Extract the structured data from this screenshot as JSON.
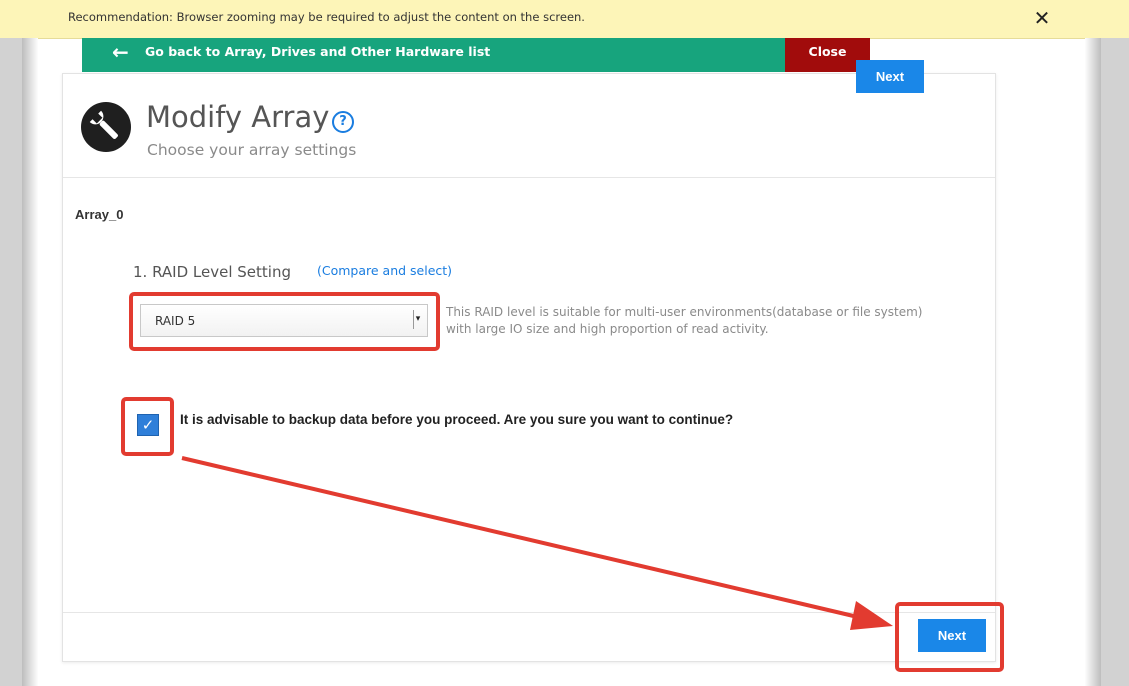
{
  "banner": {
    "text": "Recommendation: Browser zooming may be required to adjust the content on the screen.",
    "close_icon": "close-icon"
  },
  "nav": {
    "back_label": "Go back to Array, Drives and Other Hardware list",
    "back_icon": "arrow-left-icon",
    "close_label": "Close"
  },
  "header": {
    "icon": "wrench-icon",
    "title": "Modify Array",
    "help_icon": "question-circle-icon",
    "subtitle": "Choose your array settings",
    "next_label": "Next"
  },
  "array": {
    "name": "Array_0",
    "raid_label": "1. RAID Level Setting",
    "compare_link": "(Compare and select)",
    "raid_selected": "RAID 5",
    "raid_description": "This RAID level is suitable for multi-user environments(database or file system) with large IO size and high proportion of read activity."
  },
  "confirm": {
    "checked": true,
    "text": "It is advisable to backup data before you proceed. Are you sure you want to continue?"
  },
  "footer": {
    "next_label": "Next"
  },
  "colors": {
    "banner_bg": "#fdf5b8",
    "nav_green": "#17a47d",
    "close_red": "#a10c0c",
    "primary_blue": "#1a87e8",
    "highlight_red": "#e23b30"
  }
}
